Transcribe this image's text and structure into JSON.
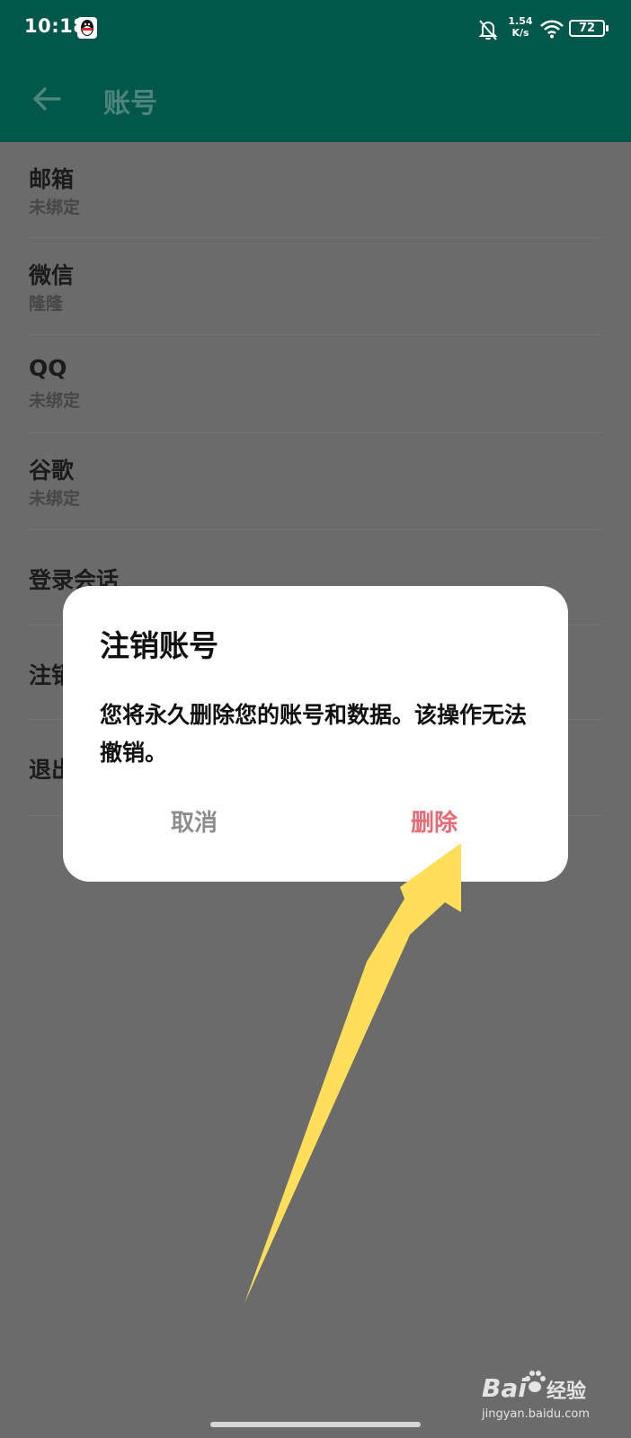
{
  "status_bar": {
    "time": "10:18",
    "net_speed_value": "1.54",
    "net_speed_unit": "K/s",
    "battery": "72",
    "icons": [
      "qq-icon",
      "bell-off-icon",
      "wifi-icon",
      "battery-icon"
    ]
  },
  "app_bar": {
    "back_icon": "arrow-left-icon",
    "title": "账号"
  },
  "list": {
    "items": [
      {
        "title": "邮箱",
        "subtitle": "未绑定"
      },
      {
        "title": "微信",
        "subtitle": "隆隆"
      },
      {
        "title": "QQ",
        "subtitle": "未绑定"
      },
      {
        "title": "谷歌",
        "subtitle": "未绑定"
      },
      {
        "title": "登录会话"
      },
      {
        "title": "注销账号"
      },
      {
        "title": "退出登录"
      }
    ]
  },
  "dialog": {
    "title": "注销账号",
    "message": "您将永久删除您的账号和数据。该操作无法撤销。",
    "cancel_label": "取消",
    "delete_label": "删除"
  },
  "watermark": {
    "brand": "Bai",
    "sub": "经验",
    "url": "jingyan.baidu.com"
  },
  "colors": {
    "header": "#00574a",
    "overlay": "#6b6b6b",
    "delete_accent": "#e46a76",
    "annotation_arrow": "#ffdf5a"
  }
}
